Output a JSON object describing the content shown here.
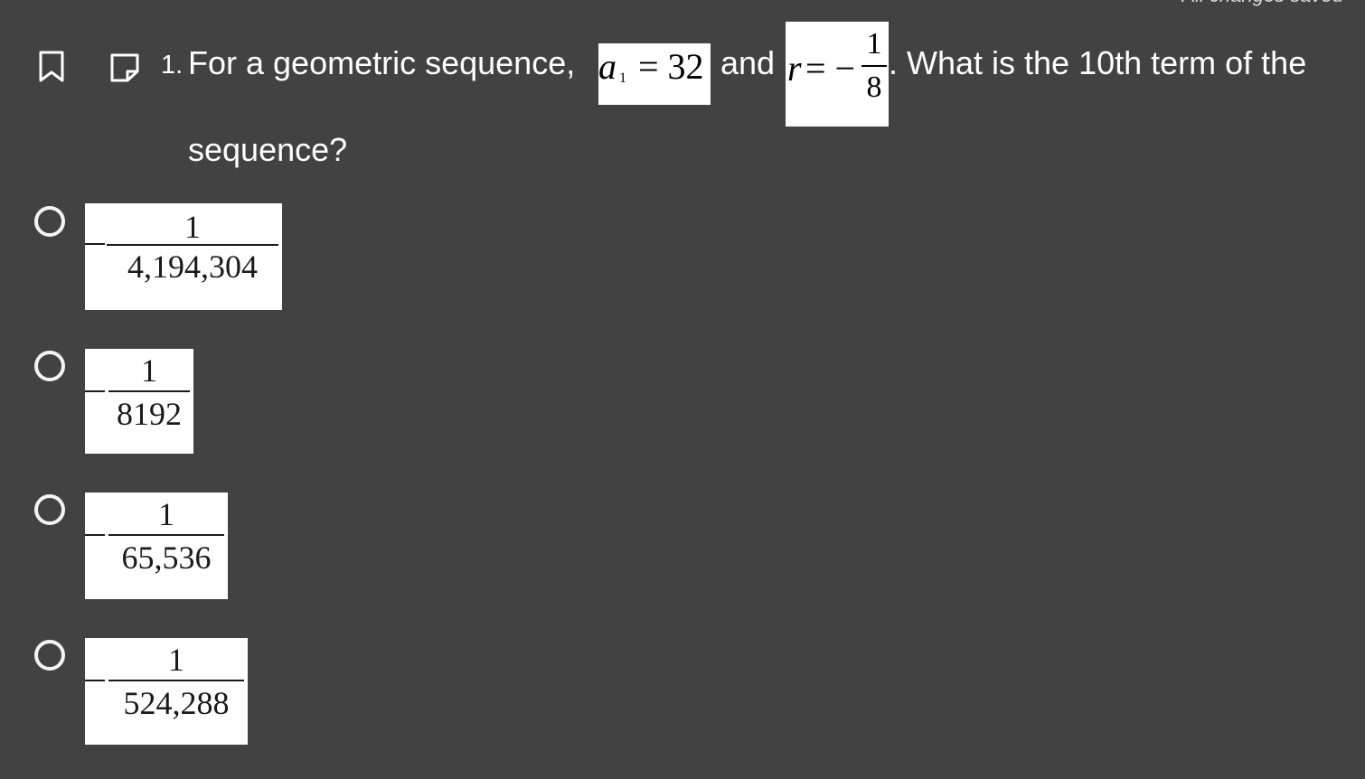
{
  "header": {
    "autosave_status": "All changes saved"
  },
  "question": {
    "number": "1.",
    "text_before": "For a geometric sequence,",
    "a1_var": "a",
    "a1_sub": "1",
    "a1_eq": "= 32",
    "and_text": "and",
    "r_var": "r",
    "r_eq": "= −",
    "r_num": "1",
    "r_den": "8",
    "text_after": ". What is the 10th term of the",
    "text_wrap": "sequence?"
  },
  "answers": [
    {
      "sign": "−",
      "numerator": "1",
      "denominator": "4,194,304"
    },
    {
      "sign": "−",
      "numerator": "1",
      "denominator": "8192"
    },
    {
      "sign": "−",
      "numerator": "1",
      "denominator": "65,536"
    },
    {
      "sign": "−",
      "numerator": "1",
      "denominator": "524,288"
    }
  ],
  "icons": [
    "bookmark-icon",
    "note-icon"
  ],
  "colors": {
    "background": "#424242",
    "text": "#ffffff",
    "math_box": "#ffffff"
  }
}
